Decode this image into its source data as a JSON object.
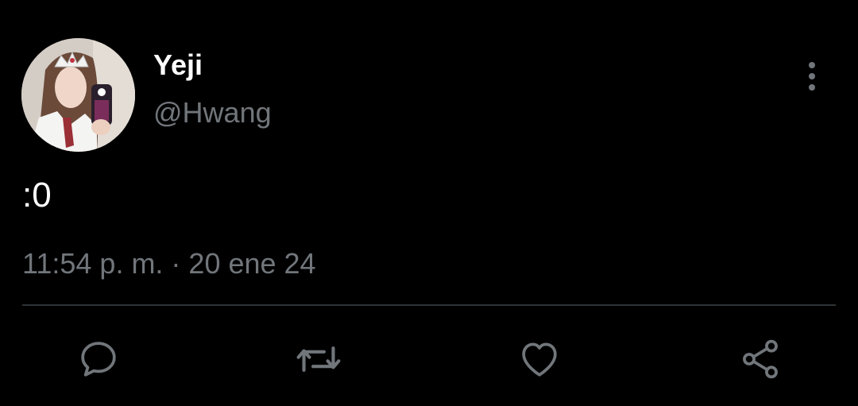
{
  "tweet": {
    "author": {
      "display_name": "Yeji",
      "handle": "@Hwang"
    },
    "text": ":0",
    "timestamp": "11:54 p. m. · 20 ene 24"
  },
  "icons": {
    "more": "more-vertical-icon",
    "reply": "reply-icon",
    "retweet": "retweet-icon",
    "like": "heart-icon",
    "share": "share-icon"
  },
  "colors": {
    "background": "#000000",
    "primary_text": "#ffffff",
    "secondary_text": "#71767b",
    "divider": "#2f3336"
  }
}
